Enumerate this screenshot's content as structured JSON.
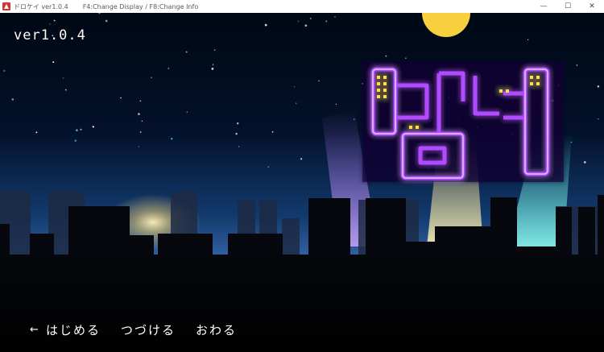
{
  "window": {
    "app_title": "ドロケイ ver1.0.4",
    "hint_text": "F4:Change Display / F8:Change Info",
    "minimize": "—",
    "maximize": "☐",
    "close": "✕"
  },
  "game": {
    "version": "ver1.0.4",
    "cursor": "←",
    "menu": [
      {
        "label": "はじめる"
      },
      {
        "label": "つづける"
      },
      {
        "label": "おわる"
      }
    ],
    "colors": {
      "sky_top": "#000814",
      "sky_horizon": "#5a86c8",
      "moon": "#f7cf3f",
      "neon": "#b04cff",
      "spot_warm": "#ffe08a",
      "spot_cyan": "#5ff0e0"
    }
  }
}
